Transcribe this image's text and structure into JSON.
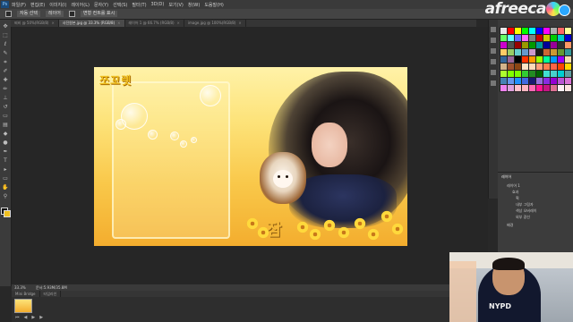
{
  "app": {
    "logo_text": "Ps"
  },
  "menu": {
    "items": [
      "파일(F)",
      "편집(E)",
      "이미지(I)",
      "레이어(L)",
      "문자(Y)",
      "선택(S)",
      "필터(T)",
      "3D(D)",
      "보기(V)",
      "창(W)",
      "도움말(H)"
    ]
  },
  "options_bar": {
    "items": [
      "자동 선택",
      "레이어",
      "변형 컨트롤 표시"
    ]
  },
  "brand": {
    "text": "afreeca"
  },
  "doc_tabs": [
    {
      "label": "찌비 @ 50%(RGB/8)",
      "active": false
    },
    {
      "label": "사진원본.jpg @ 33.3% (RGB/8)",
      "active": true
    },
    {
      "label": "레이어 1 @ 66.7% (RGB/8)",
      "active": false
    },
    {
      "label": "image.jpg @ 100%(RGB/8)",
      "active": false
    }
  ],
  "artwork": {
    "title_text": "쪼꼬렛",
    "bottom_text": "잠"
  },
  "status": {
    "zoom": "33.3%",
    "doc_info": "문서:5.93M/35.8M"
  },
  "bottom_tabs": [
    "Mini Bridge",
    "타임라인"
  ],
  "layers_panel": {
    "header": "레이어",
    "rows": [
      "레이어 1",
      "효과",
      "획",
      "내부 그림자",
      "색상 오버레이",
      "외부 광선",
      "배경"
    ]
  },
  "colors": {
    "canvas_bg": "#262626",
    "panel_bg": "#3a3a3a",
    "art_top": "#fff2a8",
    "art_bottom": "#f3ad2e"
  },
  "swatch_colors": [
    "#e8e8e8",
    "#ff0000",
    "#ffff00",
    "#00ff00",
    "#00ffff",
    "#0000ff",
    "#ff00ff",
    "#b0b0b0",
    "#ff6666",
    "#ffff99",
    "#66ff66",
    "#66ffff",
    "#6666ff",
    "#ff66ff",
    "#808080",
    "#cc0000",
    "#cccc00",
    "#00cc00",
    "#00cccc",
    "#0000cc",
    "#cc00cc",
    "#505050",
    "#990000",
    "#999900",
    "#009900",
    "#009999",
    "#000099",
    "#990099",
    "#303030",
    "#ff9966",
    "#ffcc66",
    "#99cc66",
    "#66cccc",
    "#6699cc",
    "#cc99cc",
    "#1a1a1a",
    "#cc6633",
    "#cc9933",
    "#669933",
    "#339999",
    "#336699",
    "#996699",
    "#000000",
    "#ff3300",
    "#ff9900",
    "#99ff00",
    "#00ff99",
    "#0099ff",
    "#9900ff",
    "#f5deb3",
    "#d2b48c",
    "#a0522d",
    "#8b4513",
    "#ffe4c4",
    "#ffdab9",
    "#ffa07a",
    "#ff7f50",
    "#ff6347",
    "#ff4500",
    "#ffd700",
    "#adff2f",
    "#7fff00",
    "#7cfc00",
    "#32cd32",
    "#228b22",
    "#006400",
    "#40e0d0",
    "#48d1cc",
    "#00ced1",
    "#5f9ea0",
    "#4682b4",
    "#6495ed",
    "#1e90ff",
    "#4169e1",
    "#191970",
    "#9370db",
    "#8a2be2",
    "#9400d3",
    "#ba55d3",
    "#da70d6",
    "#ee82ee",
    "#dda0dd",
    "#ffc0cb",
    "#ffb6c1",
    "#ff69b4",
    "#ff1493",
    "#c71585",
    "#db7093",
    "#fff0f5",
    "#ffe4e1"
  ]
}
